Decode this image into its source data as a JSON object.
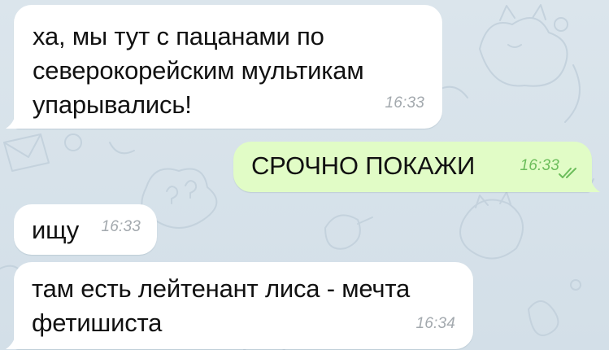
{
  "chat": {
    "messages": [
      {
        "direction": "incoming",
        "lines": [
          "ха, мы тут с пацанами по",
          "северокорейским мультикам",
          "упарывались!"
        ],
        "time": "16:33"
      },
      {
        "direction": "outgoing",
        "lines": [
          "СРОЧНО ПОКАЖИ"
        ],
        "time": "16:33",
        "status_icon": "double-check-icon"
      },
      {
        "direction": "incoming",
        "lines": [
          "ищу"
        ],
        "time": "16:33"
      },
      {
        "direction": "incoming",
        "lines": [
          "там есть лейтенант лиса - мечта",
          "фетишиста"
        ],
        "time": "16:34"
      }
    ]
  },
  "colors": {
    "background": "#d7e2ea",
    "incoming_bubble": "#ffffff",
    "outgoing_bubble": "#e1fcc6",
    "incoming_time": "#a3a9ae",
    "outgoing_time": "#6cbd5b",
    "read_check": "#6cbd5b"
  }
}
